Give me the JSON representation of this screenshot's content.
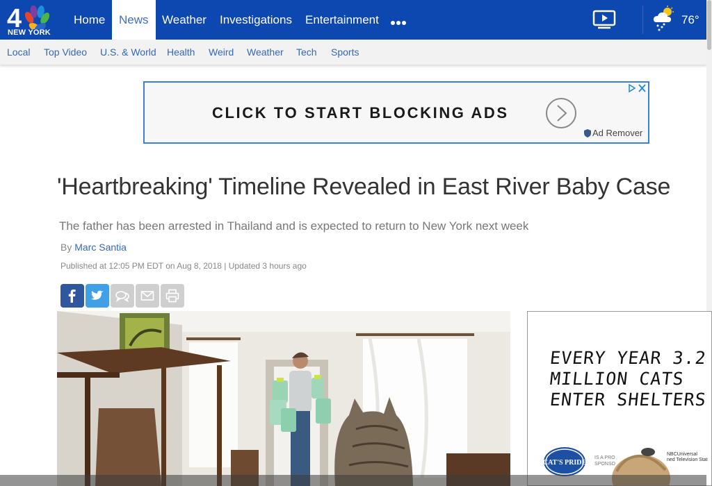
{
  "brand": {
    "logo_number": "4",
    "logo_text": "NEW YORK"
  },
  "nav": {
    "items": [
      {
        "label": "Home",
        "active": false
      },
      {
        "label": "News",
        "active": true
      },
      {
        "label": "Weather",
        "active": false
      },
      {
        "label": "Investigations",
        "active": false
      },
      {
        "label": "Entertainment",
        "active": false
      }
    ],
    "more_icon": "ellipsis-icon",
    "video_icon": "video-play-icon",
    "weather": {
      "icon": "cloud-sun-snow-icon",
      "temp": "76°"
    }
  },
  "subnav": {
    "items": [
      "Local",
      "Top Video",
      "U.S. & World",
      "Health",
      "Weird",
      "Weather",
      "Tech",
      "Sports"
    ]
  },
  "ad_banner": {
    "text": "CLICK TO START BLOCKING ADS",
    "brand": "Ad Remover",
    "arrow_icon": "circle-arrow-right-icon",
    "choices_icon": "adchoices-icon"
  },
  "article": {
    "headline": "'Heartbreaking' Timeline Revealed in East River Baby Case",
    "subheadline": "The father has been arrested in Thailand and is expected to return to New York next week",
    "byline_prefix": "By",
    "author": "Marc Santia",
    "published": "Published at 12:05 PM EDT on Aug 8, 2018 | Updated 3 hours ago",
    "share": [
      "facebook-icon",
      "twitter-icon",
      "comments-icon",
      "email-icon",
      "print-icon"
    ]
  },
  "side_ad": {
    "lines": [
      "EVERY YEAR 3.2",
      "MILLION CATS",
      "ENTER SHELTERS"
    ],
    "logo_text": "CAT'S PRIDE",
    "sponsor_text": "IS A PRO\nSPONSO",
    "nbcu_text": "NBCUniversal\nned Television Stat"
  },
  "colors": {
    "nav_bg": "#0d47b0",
    "link": "#3467b7",
    "facebook": "#30579e",
    "twitter": "#3fa0e8",
    "ad_border": "#3d7fd6"
  }
}
